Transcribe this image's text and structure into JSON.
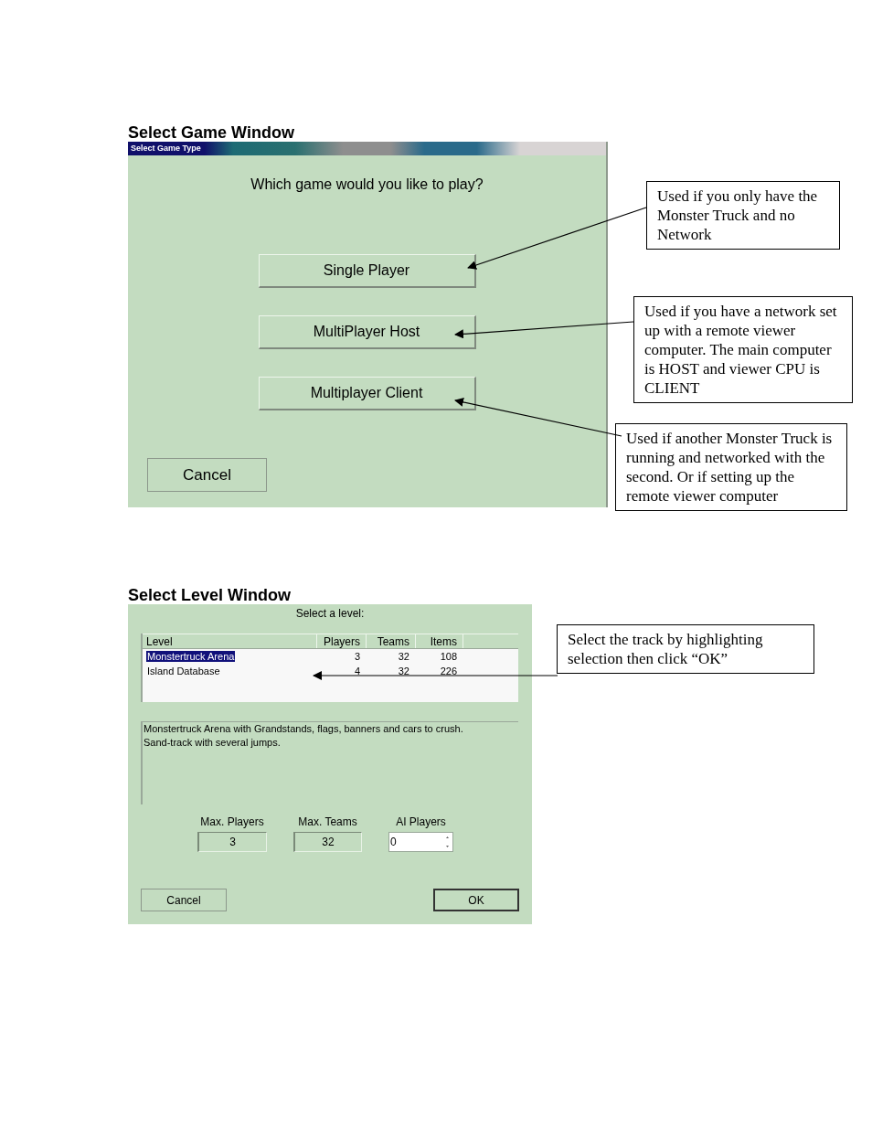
{
  "game_window": {
    "heading": "Select Game Window",
    "title": "Select Game Type",
    "question": "Which game would you like to play?",
    "buttons": [
      {
        "label": "Single Player"
      },
      {
        "label": "MultiPlayer Host"
      },
      {
        "label": "Multiplayer Client"
      }
    ],
    "cancel": "Cancel"
  },
  "level_window": {
    "heading": "Select Level Window",
    "prompt": "Select a level:",
    "columns": [
      "Level",
      "Players",
      "Teams",
      "Items"
    ],
    "rows": [
      {
        "cells": [
          "Monstertruck Arena",
          "3",
          "32",
          "108"
        ],
        "selected": true
      },
      {
        "cells": [
          "Island Database",
          "4",
          "32",
          "226"
        ],
        "selected": false
      }
    ],
    "description": [
      "Monstertruck Arena with Grandstands, flags, banners and cars to crush.",
      "Sand-track with several jumps."
    ],
    "fields": [
      {
        "label": "Max. Players",
        "value": "3",
        "kind": "readonly"
      },
      {
        "label": "Max. Teams",
        "value": "32",
        "kind": "readonly"
      },
      {
        "label": "AI Players",
        "value": "0",
        "kind": "spinner"
      }
    ],
    "buttons": [
      {
        "label": "Cancel",
        "default": false
      },
      {
        "label": "OK",
        "default": true
      }
    ]
  },
  "callouts": [
    {
      "text": "Used if you only have the Monster Truck and no Network"
    },
    {
      "text": "Used if you have a network set up with a remote viewer computer.  The main computer is HOST and viewer CPU is CLIENT"
    },
    {
      "text": "Used if another Monster Truck is running and networked with the second. Or if setting up the remote viewer computer"
    },
    {
      "text": "Select the track by highlighting selection then click “OK”"
    }
  ]
}
